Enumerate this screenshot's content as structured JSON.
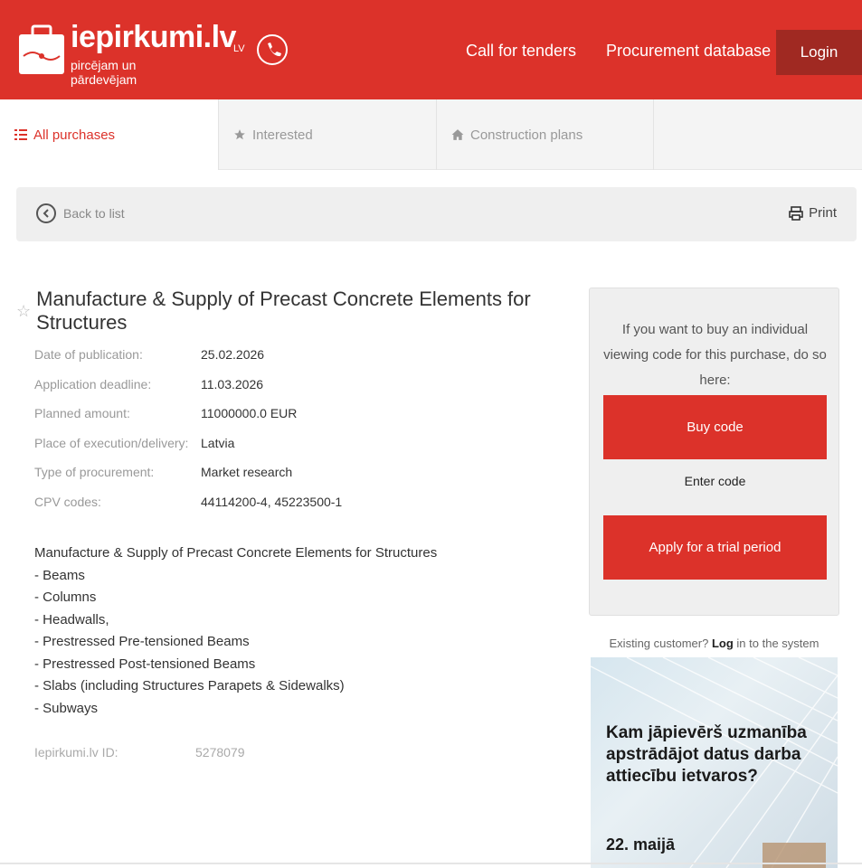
{
  "header": {
    "logo_name": "iepirkumi.lv",
    "logo_tagline": "pircējam un pārdevējam",
    "lang": "LV",
    "nav": {
      "call_for_tenders": "Call for tenders",
      "procurement_database": "Procurement database"
    },
    "login": "Login"
  },
  "tabs": {
    "all": "All purchases",
    "interested": "Interested",
    "construction": "Construction plans"
  },
  "backbar": {
    "back": "Back to list",
    "print": "Print"
  },
  "purchase": {
    "title": "Manufacture & Supply of Precast Concrete Elements for Structures",
    "details": [
      {
        "label": "Date of publication:",
        "value": "25.02.2026"
      },
      {
        "label": "Application deadline:",
        "value": "11.03.2026"
      },
      {
        "label": "Planned amount:",
        "value": "11000000.0 EUR"
      },
      {
        "label": "Place of execution/delivery:",
        "value": "Latvia"
      },
      {
        "label": "Type of procurement:",
        "value": "Market research"
      },
      {
        "label": "CPV codes:",
        "value": "44114200-4, 45223500-1"
      }
    ],
    "description_lines": [
      "Manufacture & Supply of Precast Concrete Elements for Structures",
      "- Beams",
      "- Columns",
      "- Headwalls,",
      "- Prestressed Pre-tensioned Beams",
      "- Prestressed Post-tensioned Beams",
      "- Slabs (including Structures Parapets & Sidewalks)",
      "- Subways"
    ],
    "id_label": "Iepirkumi.lv ID:",
    "id_value": "5278079"
  },
  "sidebar": {
    "intro": "If you want to buy an individual viewing code for this purchase, do so here:",
    "buy_code": "Buy code",
    "enter_code": "Enter code",
    "trial": "Apply for a trial period",
    "existing_prefix": "Existing customer?",
    "existing_login": "Log",
    "existing_suffix": "in to the system"
  },
  "ad": {
    "headline": "Kam jāpievērš uzmanība apstrādājot datus darba attiecību ietvaros?",
    "date": "22. maijā"
  },
  "colors": {
    "brand_red": "#dc322a",
    "dark_red": "#a02922"
  }
}
